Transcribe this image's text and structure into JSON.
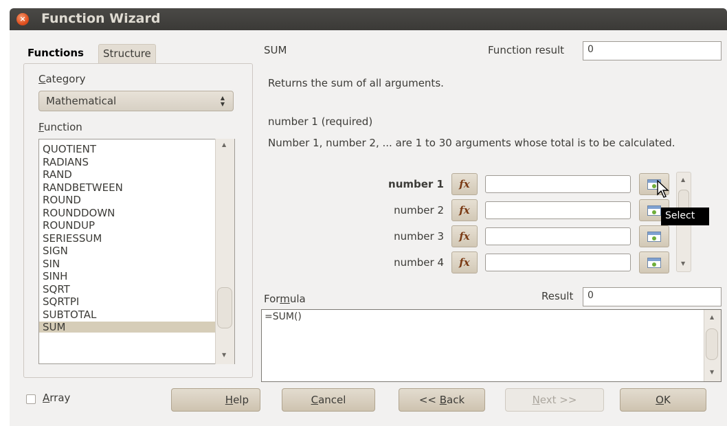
{
  "window": {
    "title": "Function Wizard",
    "close_glyph": "×"
  },
  "tabs": {
    "functions": "Functions",
    "structure": "Structure"
  },
  "left": {
    "category_label_u": "C",
    "category_label_rest": "ategory",
    "category_value": "Mathematical",
    "function_label_u": "F",
    "function_label_rest": "unction",
    "functions": [
      "QUOTIENT",
      "RADIANS",
      "RAND",
      "RANDBETWEEN",
      "ROUND",
      "ROUNDDOWN",
      "ROUNDUP",
      "SERIESSUM",
      "SIGN",
      "SIN",
      "SINH",
      "SQRT",
      "SQRTPI",
      "SUBTOTAL",
      "SUM"
    ],
    "selected": "SUM"
  },
  "right": {
    "function_name": "SUM",
    "function_result_label": "Function result",
    "function_result_value": "0",
    "description": "Returns the sum of all arguments.",
    "arg_required": "number 1 (required)",
    "arg_description": "Number 1, number 2, ... are 1 to 30 arguments whose total is to be calculated.",
    "args": [
      {
        "label": "number 1",
        "value": ""
      },
      {
        "label": "number 2",
        "value": ""
      },
      {
        "label": "number 3",
        "value": ""
      },
      {
        "label": "number 4",
        "value": ""
      }
    ],
    "fx_glyph": "fx",
    "tooltip": "Select",
    "formula_label_pre": "For",
    "formula_label_u": "m",
    "formula_label_post": "ula",
    "result_label": "Result",
    "result_value": "0",
    "formula_value": "=SUM()"
  },
  "bottom": {
    "array_label_u": "A",
    "array_label_rest": "rray",
    "help_u": "H",
    "help_rest": "elp",
    "cancel_u": "C",
    "cancel_rest": "ancel",
    "back_pre": "<< ",
    "back_u": "B",
    "back_rest": "ack",
    "next_u": "N",
    "next_rest": "ext >>",
    "ok_u": "O",
    "ok_rest": "K"
  }
}
